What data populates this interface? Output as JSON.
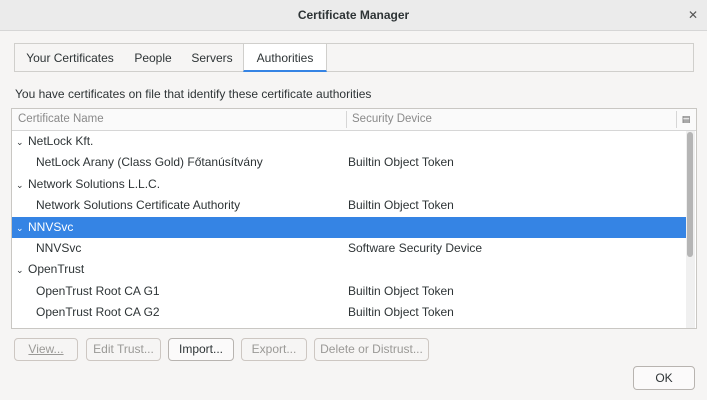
{
  "window": {
    "title": "Certificate Manager",
    "close_glyph": "✕"
  },
  "tabs": [
    {
      "label": "Your Certificates",
      "active": false
    },
    {
      "label": "People",
      "active": false
    },
    {
      "label": "Servers",
      "active": false
    },
    {
      "label": "Authorities",
      "active": true
    }
  ],
  "intro_text": "You have certificates on file that identify these certificate authorities",
  "table": {
    "columns": [
      "Certificate Name",
      "Security Device"
    ],
    "column_picker_icon": "column-picker-icon",
    "rows": [
      {
        "type": "group",
        "name": "NetLock Kft.",
        "device": "",
        "selected": false
      },
      {
        "type": "child",
        "name": "NetLock Arany (Class Gold) Főtanúsítvány",
        "device": "Builtin Object Token",
        "selected": false
      },
      {
        "type": "group",
        "name": "Network Solutions L.L.C.",
        "device": "",
        "selected": false
      },
      {
        "type": "child",
        "name": "Network Solutions Certificate Authority",
        "device": "Builtin Object Token",
        "selected": false
      },
      {
        "type": "group",
        "name": "NNVSvc",
        "device": "",
        "selected": true
      },
      {
        "type": "child",
        "name": "NNVSvc",
        "device": "Software Security Device",
        "selected": false
      },
      {
        "type": "group",
        "name": "OpenTrust",
        "device": "",
        "selected": false
      },
      {
        "type": "child",
        "name": "OpenTrust Root CA G1",
        "device": "Builtin Object Token",
        "selected": false
      },
      {
        "type": "child",
        "name": "OpenTrust Root CA G2",
        "device": "Builtin Object Token",
        "selected": false
      }
    ]
  },
  "buttons": {
    "view": "View...",
    "edit_trust": "Edit Trust...",
    "import": "Import...",
    "export": "Export...",
    "delete": "Delete or Distrust...",
    "ok": "OK"
  },
  "colors": {
    "accent": "#3584e4"
  }
}
